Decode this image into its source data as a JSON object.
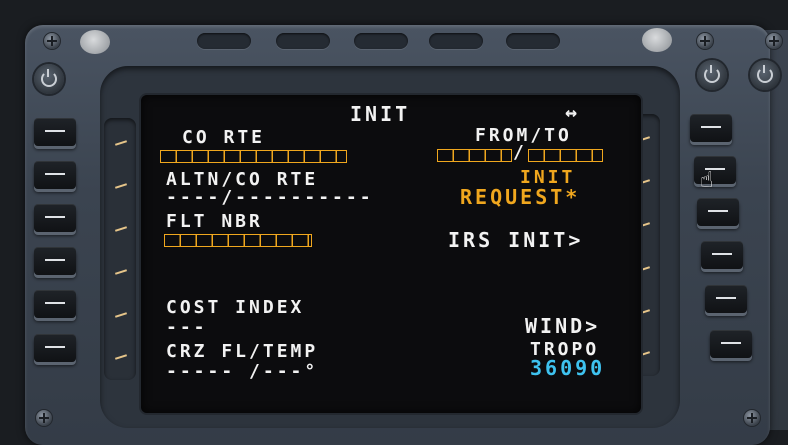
{
  "page": {
    "title": "INIT",
    "arrows": "↔"
  },
  "left": [
    {
      "label": "CO RTE",
      "value_boxes": 11
    },
    {
      "label": "ALTN/CO RTE",
      "value": "----/----------"
    },
    {
      "label": "FLT NBR",
      "value_boxes": 8
    },
    {
      "label": "",
      "value": ""
    },
    {
      "label": "COST INDEX",
      "value": "---"
    },
    {
      "label": "CRZ FL/TEMP",
      "value": "----- /---°"
    }
  ],
  "right": [
    {
      "label": "FROM/TO",
      "value_boxes": [
        5,
        5
      ],
      "separator": "/"
    },
    {
      "label": "INIT",
      "value": "REQUEST*"
    },
    {
      "label": "",
      "value": "IRS INIT>"
    },
    {
      "label": "",
      "value": ""
    },
    {
      "label": "",
      "value": "WIND>"
    },
    {
      "label": "TROPO",
      "value": "36090"
    }
  ],
  "colors": {
    "amber": "#f0a71e",
    "cyan": "#3ec2ef",
    "white": "#f2f2f2",
    "screen": "#0c0c0e"
  },
  "icons": [
    "screw-icon",
    "brightness-knob-icon",
    "hand-cursor-icon"
  ]
}
